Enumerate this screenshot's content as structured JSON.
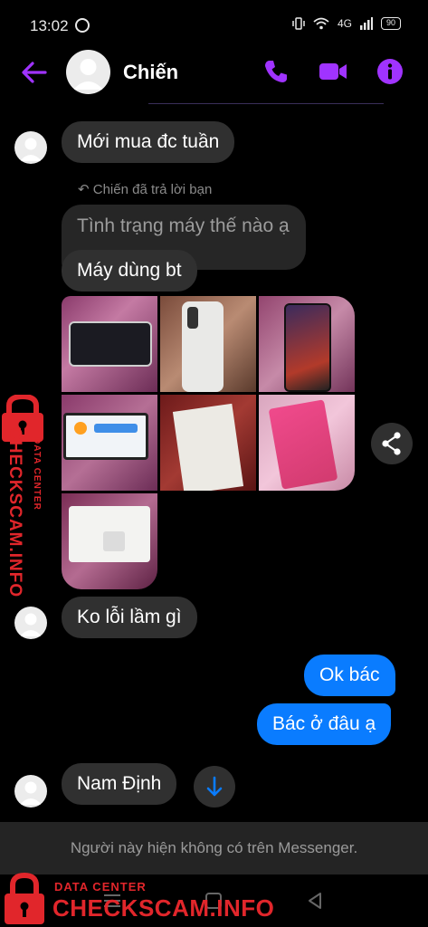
{
  "status_bar": {
    "time": "13:02",
    "network": "4G",
    "battery": "90"
  },
  "header": {
    "contact_name": "Chiến",
    "icons": [
      "back-arrow-icon",
      "phone-icon",
      "video-camera-icon",
      "info-icon"
    ],
    "accent_color": "#a033ff"
  },
  "messages": {
    "m1": "Mới mua đc  tuần",
    "reply_note": "Chiến đã trả lời bạn",
    "quoted": "Tình trạng máy thế nào ạ",
    "m2": "Máy dùng bt",
    "m3": "Ko lỗi lầm gì",
    "mine1": "Ok bác",
    "mine2": "Bác ở đâu ạ",
    "m4": "Nam Định"
  },
  "photos": [
    "phone-on-fabric",
    "phone-back-in-hand",
    "phone-homescreen",
    "phone-settings-screen",
    "phone-box-label",
    "joy4-box",
    "charger-accessories"
  ],
  "footer": {
    "notice": "Người này hiện không có trên Messenger."
  },
  "watermark": {
    "small": "DATA CENTER",
    "big": "CHECKSCAM.INFO",
    "color": "#e1262b"
  }
}
